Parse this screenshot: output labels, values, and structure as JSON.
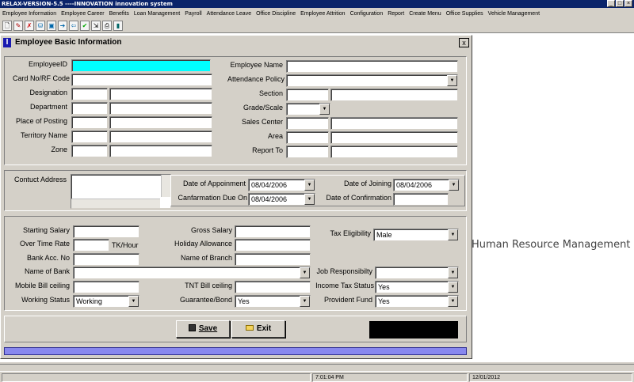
{
  "window": {
    "title": "RELAX-VERSION-5.5 ----INNOVATION innovation system"
  },
  "menu": [
    "Employee Information",
    "Employee Career",
    "Benefits",
    "Loan Management",
    "Payroll",
    "Attendance Leave",
    "Office Discipline",
    "Employee Attrition",
    "Configuration",
    "Report",
    "Create Menu",
    "Office Supplies",
    "Vehicle Management"
  ],
  "background_text": "Human Resource Management",
  "dialog": {
    "title": "Employee Basic Information",
    "close_glyph": "x",
    "basic": {
      "employee_id_label": "EmployeeID",
      "card_no_label": "Card No/RF Code",
      "designation_label": "Designation",
      "department_label": "Department",
      "place_of_posting_label": "Place of Posting",
      "territory_name_label": "Territory Name",
      "zone_label": "Zone",
      "employee_name_label": "Employee Name",
      "attendance_policy_label": "Attendance Policy",
      "section_label": "Section",
      "grade_scale_label": "Grade/Scale",
      "sales_center_label": "Sales Center",
      "area_label": "Area",
      "report_to_label": "Report To"
    },
    "address": {
      "contact_address_label": "Contuct Address",
      "date_of_appointment_label": "Date of Appoinment",
      "date_of_appointment_value": "08/04/2006",
      "date_of_joining_label": "Date of Joining",
      "date_of_joining_value": "08/04/2006",
      "confirmation_due_label": "Canfarmation Due On",
      "confirmation_due_value": "08/04/2006",
      "date_of_confirmation_label": "Date of Confirmation"
    },
    "salary": {
      "starting_salary_label": "Starting Salary",
      "over_time_rate_label": "Over Time Rate",
      "tk_hour_label": "TK/Hour",
      "bank_acc_label": "Bank Acc. No",
      "name_of_bank_label": "Name of Bank",
      "mobile_bill_label": "Mobile Bill ceiling",
      "working_status_label": "Working Status",
      "working_status_value": "Working",
      "gross_salary_label": "Gross Salary",
      "holiday_allowance_label": "Holiday Allowance",
      "name_of_branch_label": "Name of Branch",
      "tnt_bill_label": "TNT Bill ceiling",
      "guarantee_bond_label": "Guarantee/Bond",
      "guarantee_bond_value": "Yes",
      "tax_eligibility_label": "Tax Eligibility",
      "tax_eligibility_value": "Male",
      "job_responsibility_label": "Job Responsibilty",
      "income_tax_status_label": "Income Tax Status",
      "income_tax_status_value": "Yes",
      "provident_fund_label": "Provident Fund",
      "provident_fund_value": "Yes"
    },
    "buttons": {
      "save": "Save",
      "exit": "Exit"
    }
  },
  "status": {
    "time": "7:01:04 PM",
    "date": "12/01/2012"
  }
}
